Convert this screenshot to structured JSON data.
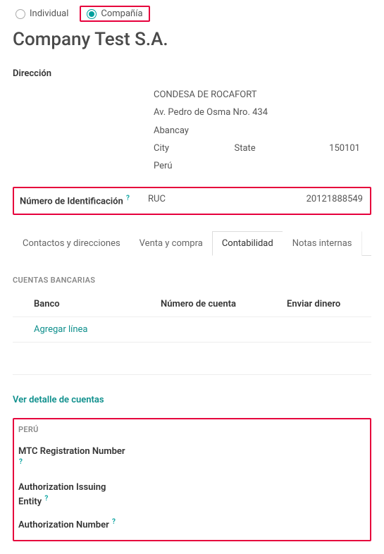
{
  "type_radio": {
    "individual": "Individual",
    "company": "Compañía",
    "selected": "company"
  },
  "title": "Company Test S.A.",
  "address": {
    "label": "Dirección",
    "name": "CONDESA DE ROCAFORT",
    "street": "Av. Pedro de Osma Nro. 434",
    "district": "Abancay",
    "city": "City",
    "state": "State",
    "zip": "150101",
    "country": "Perú"
  },
  "identification": {
    "label": "Número de Identificación",
    "help": "?",
    "type": "RUC",
    "number": "20121888549"
  },
  "tabs": {
    "contacts": "Contactos y direcciones",
    "sales": "Venta y compra",
    "accounting": "Contabilidad",
    "notes": "Notas internas",
    "active": "accounting"
  },
  "bank": {
    "heading": "CUENTAS BANCARIAS",
    "col_bank": "Banco",
    "col_number": "Número de cuenta",
    "col_send": "Enviar dinero",
    "add_line": "Agregar línea"
  },
  "accounts_link": "Ver detalle de cuentas",
  "peru": {
    "heading": "PERÚ",
    "fields": {
      "mtc": {
        "label": "MTC Registration Number",
        "help": "?"
      },
      "auth_entity": {
        "label": "Authorization Issuing Entity",
        "help": "?"
      },
      "auth_number": {
        "label": "Authorization Number",
        "help": "?"
      }
    }
  }
}
